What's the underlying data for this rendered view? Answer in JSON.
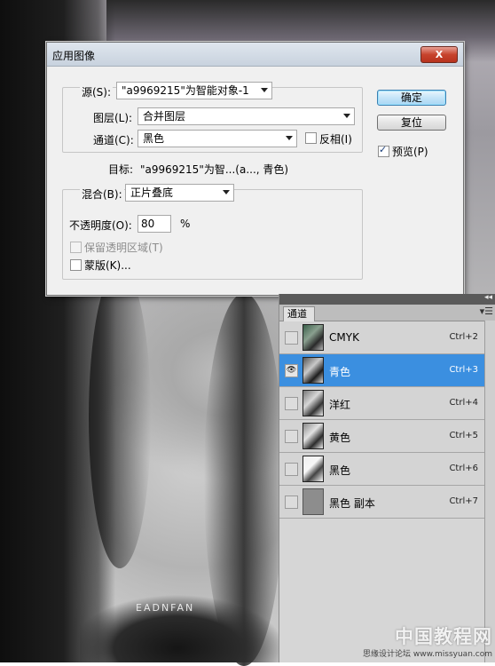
{
  "dialog": {
    "title": "应用图像",
    "close_label": "X",
    "source_label": "源(S):",
    "source_value": "\"a9969215\"为智能对象-1",
    "layer_label": "图层(L):",
    "layer_value": "合并图层",
    "channel_label": "通道(C):",
    "channel_value": "黑色",
    "invert_label": "反相(I)",
    "target_label": "目标:",
    "target_value": "\"a9969215\"为智...(a..., 青色)",
    "blending_label": "混合(B):",
    "blending_value": "正片叠底",
    "opacity_label": "不透明度(O):",
    "opacity_value": "80",
    "opacity_unit": "%",
    "preserve_label": "保留透明区域(T)",
    "mask_label": "蒙版(K)...",
    "ok_label": "确定",
    "reset_label": "复位",
    "preview_label": "预览(P)",
    "preview_checked": true
  },
  "channels_panel": {
    "tab_label": "通道",
    "menu_icon": "panel-menu-icon",
    "collapse_icon": "◂◂",
    "rows": [
      {
        "name": "CMYK",
        "shortcut": "Ctrl+2",
        "selected": false,
        "visible": false
      },
      {
        "name": "青色",
        "shortcut": "Ctrl+3",
        "selected": true,
        "visible": true
      },
      {
        "name": "洋红",
        "shortcut": "Ctrl+4",
        "selected": false,
        "visible": false
      },
      {
        "name": "黄色",
        "shortcut": "Ctrl+5",
        "selected": false,
        "visible": false
      },
      {
        "name": "黑色",
        "shortcut": "Ctrl+6",
        "selected": false,
        "visible": false
      },
      {
        "name": "黑色 副本",
        "shortcut": "Ctrl+7",
        "selected": false,
        "visible": false
      }
    ]
  },
  "photo": {
    "caption": "EADNFAN"
  },
  "watermark": {
    "big": "中国教程网",
    "small": "思缘设计论坛 www.missyuan.com"
  }
}
